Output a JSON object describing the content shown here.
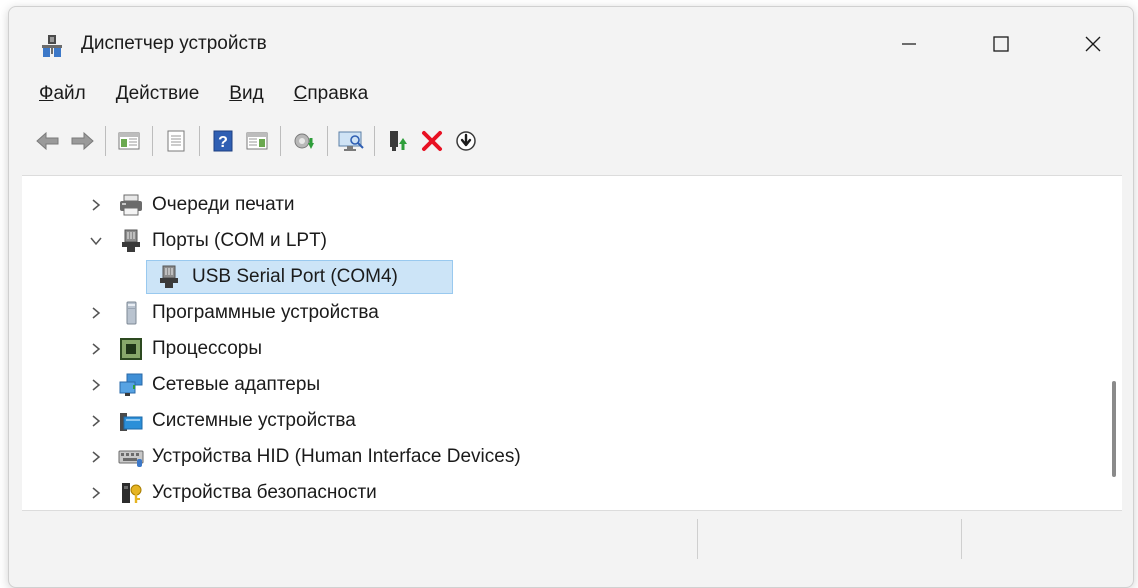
{
  "window": {
    "title": "Диспетчер устройств",
    "icon": "device-manager-icon"
  },
  "menu": [
    {
      "key": "file",
      "text": "Файл",
      "u": "Ф",
      "rest": "айл"
    },
    {
      "key": "action",
      "text": "Действие",
      "u": "Д",
      "rest": "ействие"
    },
    {
      "key": "view",
      "text": "Вид",
      "u": "В",
      "rest": "ид"
    },
    {
      "key": "help",
      "text": "Справка",
      "u": "С",
      "rest": "правка"
    }
  ],
  "toolbar": [
    "back-icon",
    "forward-icon",
    "console-tree-icon",
    "properties-icon",
    "help-icon",
    "action-pane-icon",
    "update-driver-icon",
    "scan-hardware-icon",
    "enable-device-icon",
    "uninstall-device-icon",
    "disable-device-icon"
  ],
  "tree": {
    "items": [
      {
        "label": "Очереди печати",
        "icon": "printer-icon",
        "expanded": false
      },
      {
        "label": "Порты (COM и LPT)",
        "icon": "port-icon",
        "expanded": true
      },
      {
        "label": "USB Serial Port (COM4)",
        "icon": "port-icon",
        "child": true,
        "selected": true
      },
      {
        "label": "Программные устройства",
        "icon": "software-device-icon",
        "expanded": false
      },
      {
        "label": "Процессоры",
        "icon": "processor-icon",
        "expanded": false
      },
      {
        "label": "Сетевые адаптеры",
        "icon": "network-adapter-icon",
        "expanded": false
      },
      {
        "label": "Системные устройства",
        "icon": "system-devices-icon",
        "expanded": false
      },
      {
        "label": "Устройства HID (Human Interface Devices)",
        "icon": "hid-icon",
        "expanded": false
      },
      {
        "label": "Устройства безопасности",
        "icon": "security-device-icon",
        "expanded": false
      }
    ]
  },
  "colors": {
    "selection": "#cce4f7",
    "selection_border": "#99c9ef",
    "red_x": "#e81123"
  }
}
